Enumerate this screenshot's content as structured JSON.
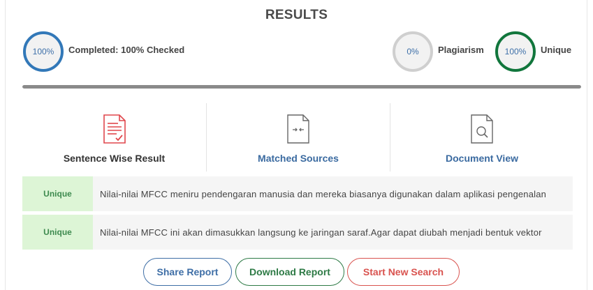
{
  "header": {
    "title": "RESULTS"
  },
  "stats": {
    "completed": {
      "value": "100%",
      "label": "Completed: 100% Checked",
      "color": "#3278b8"
    },
    "plagiarism": {
      "value": "0%",
      "label": "Plagiarism",
      "color": "#cfcfcf"
    },
    "unique": {
      "value": "100%",
      "label": "Unique",
      "color": "#11763c"
    }
  },
  "progress": {
    "completed_fraction": 1.0
  },
  "tabs": [
    {
      "label": "Sentence Wise Result",
      "icon": "document-check-icon"
    },
    {
      "label": "Matched Sources",
      "icon": "document-compare-icon"
    },
    {
      "label": "Document View",
      "icon": "document-search-icon"
    }
  ],
  "results": [
    {
      "status": "Unique",
      "text": "Nilai-nilai MFCC meniru pendengaran manusia dan mereka biasanya digunakan dalam aplikasi pengenalan"
    },
    {
      "status": "Unique",
      "text": "Nilai-nilai MFCC ini akan dimasukkan langsung ke jaringan saraf.Agar dapat diubah menjadi bentuk vektor"
    }
  ],
  "actions": {
    "share": "Share Report",
    "download": "Download Report",
    "new_search": "Start New Search"
  }
}
